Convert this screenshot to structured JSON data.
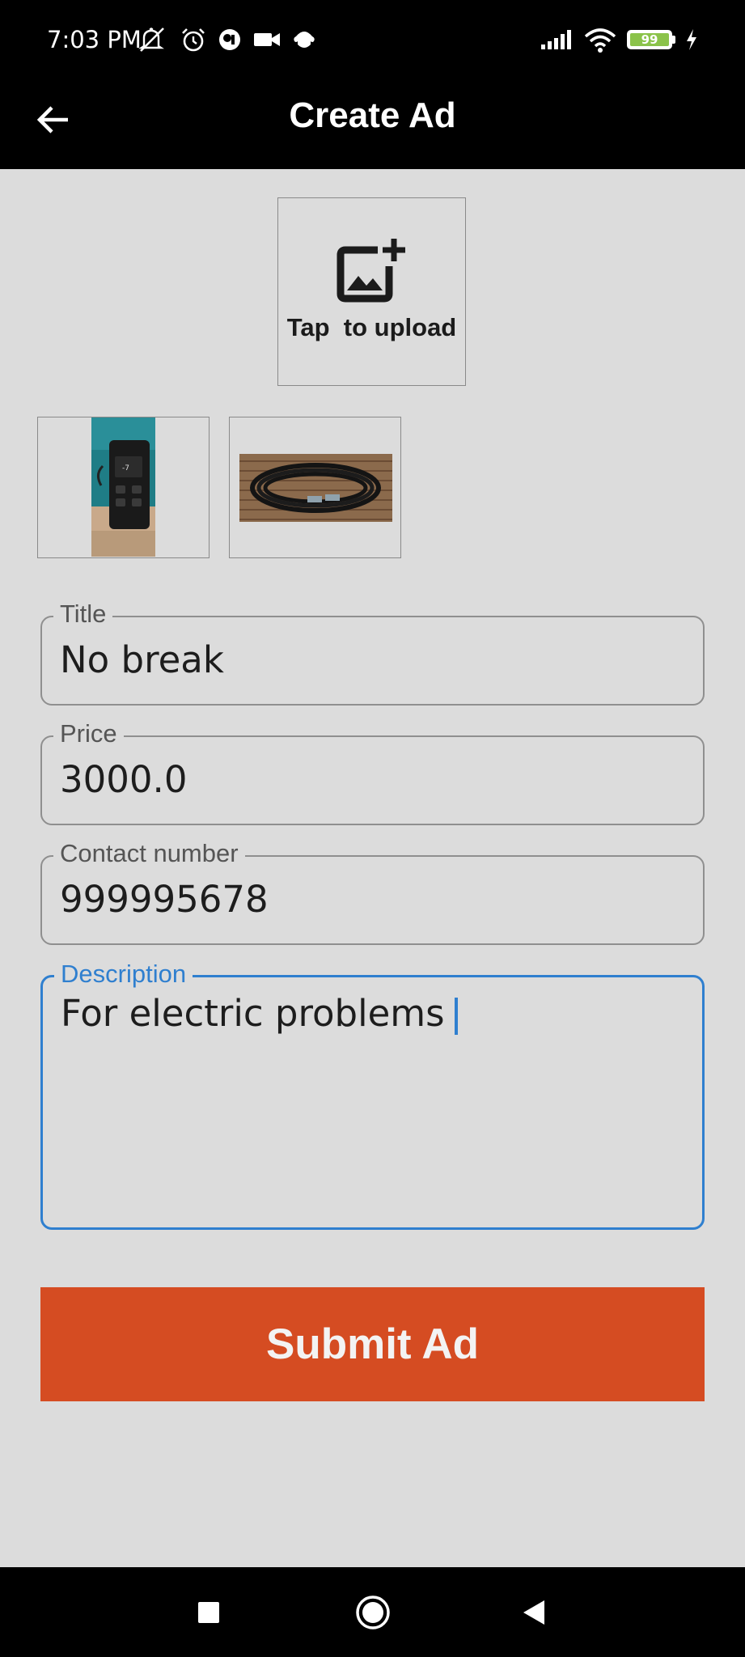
{
  "status_bar": {
    "time": "7:03 PM",
    "left_icons": [
      "mute-icon",
      "alarm-icon",
      "app-notification-icon",
      "video-icon",
      "app-icon"
    ],
    "right_icons": [
      "signal-icon",
      "wifi-icon"
    ],
    "battery_level": "99",
    "charging": true
  },
  "app_bar": {
    "title": "Create Ad",
    "back_icon": "arrow-left-icon"
  },
  "upload": {
    "label": "Tap  to upload",
    "icon": "add-photo-icon"
  },
  "thumbnails": [
    {
      "name": "photo-ups-device"
    },
    {
      "name": "photo-cable"
    }
  ],
  "form": {
    "title": {
      "label": "Title",
      "value": "No break"
    },
    "price": {
      "label": "Price",
      "value": "3000.0"
    },
    "contact": {
      "label": "Contact number",
      "value": "999995678"
    },
    "description": {
      "label": "Description",
      "value": "For electric problems"
    }
  },
  "submit": {
    "label": "Submit Ad"
  },
  "colors": {
    "accent": "#d54c22",
    "focus": "#2f7fcf",
    "background": "#dcdcdc"
  },
  "nav_bar": {
    "items": [
      "recents-square-icon",
      "home-circle-icon",
      "back-triangle-icon"
    ]
  }
}
